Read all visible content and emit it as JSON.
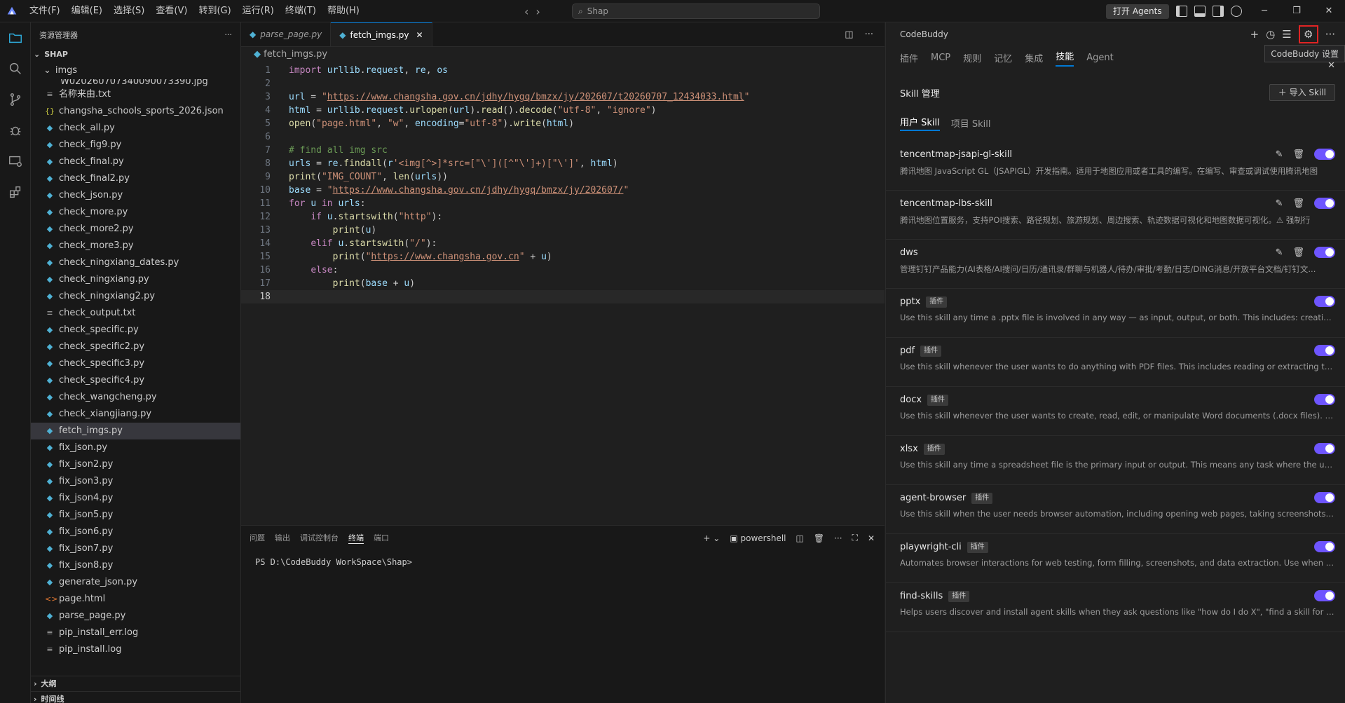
{
  "menu": [
    "文件(F)",
    "编辑(E)",
    "选择(S)",
    "查看(V)",
    "转到(G)",
    "运行(R)",
    "终端(T)",
    "帮助(H)"
  ],
  "search": {
    "text": "Shap"
  },
  "open_agents_label": "打开 Agents",
  "explorer": {
    "title": "资源管理器",
    "root": "SHAP",
    "folder": "imgs",
    "partial_file": "W020260707340090073390.jpg",
    "files": [
      {
        "name": "名称来由.txt",
        "type": "txt"
      },
      {
        "name": "changsha_schools_sports_2026.json",
        "type": "json"
      },
      {
        "name": "check_all.py",
        "type": "py"
      },
      {
        "name": "check_fig9.py",
        "type": "py"
      },
      {
        "name": "check_final.py",
        "type": "py"
      },
      {
        "name": "check_final2.py",
        "type": "py"
      },
      {
        "name": "check_json.py",
        "type": "py"
      },
      {
        "name": "check_more.py",
        "type": "py"
      },
      {
        "name": "check_more2.py",
        "type": "py"
      },
      {
        "name": "check_more3.py",
        "type": "py"
      },
      {
        "name": "check_ningxiang_dates.py",
        "type": "py"
      },
      {
        "name": "check_ningxiang.py",
        "type": "py"
      },
      {
        "name": "check_ningxiang2.py",
        "type": "py"
      },
      {
        "name": "check_output.txt",
        "type": "txt"
      },
      {
        "name": "check_specific.py",
        "type": "py"
      },
      {
        "name": "check_specific2.py",
        "type": "py"
      },
      {
        "name": "check_specific3.py",
        "type": "py"
      },
      {
        "name": "check_specific4.py",
        "type": "py"
      },
      {
        "name": "check_wangcheng.py",
        "type": "py"
      },
      {
        "name": "check_xiangjiang.py",
        "type": "py"
      },
      {
        "name": "fetch_imgs.py",
        "type": "py",
        "active": true
      },
      {
        "name": "fix_json.py",
        "type": "py"
      },
      {
        "name": "fix_json2.py",
        "type": "py"
      },
      {
        "name": "fix_json3.py",
        "type": "py"
      },
      {
        "name": "fix_json4.py",
        "type": "py"
      },
      {
        "name": "fix_json5.py",
        "type": "py"
      },
      {
        "name": "fix_json6.py",
        "type": "py"
      },
      {
        "name": "fix_json7.py",
        "type": "py"
      },
      {
        "name": "fix_json8.py",
        "type": "py"
      },
      {
        "name": "generate_json.py",
        "type": "py"
      },
      {
        "name": "page.html",
        "type": "html"
      },
      {
        "name": "parse_page.py",
        "type": "py"
      },
      {
        "name": "pip_install_err.log",
        "type": "txt"
      },
      {
        "name": "pip_install.log",
        "type": "txt"
      }
    ],
    "outline": "大纲",
    "timeline": "时间线"
  },
  "tabs": [
    {
      "label": "parse_page.py",
      "active": false
    },
    {
      "label": "fetch_imgs.py",
      "active": true
    }
  ],
  "breadcrumb": "fetch_imgs.py",
  "code_lines": [
    "import urllib.request, re, os",
    "",
    "url = \"https://www.changsha.gov.cn/jdhy/hygq/bmzx/jy/202607/t20260707_12434033.html\"",
    "html = urllib.request.urlopen(url).read().decode(\"utf-8\", \"ignore\")",
    "open(\"page.html\", \"w\", encoding=\"utf-8\").write(html)",
    "",
    "# find all img src",
    "urls = re.findall(r'<img[^>]*src=[\"\\']([^\"\\']+)[\"\\']', html)",
    "print(\"IMG_COUNT\", len(urls))",
    "base = \"https://www.changsha.gov.cn/jdhy/hygq/bmzx/jy/202607/\"",
    "for u in urls:",
    "    if u.startswith(\"http\"):",
    "        print(u)",
    "    elif u.startswith(\"/\"):",
    "        print(\"https://www.changsha.gov.cn\" + u)",
    "    else:",
    "        print(base + u)",
    ""
  ],
  "panel": {
    "tabs": [
      "问题",
      "输出",
      "调试控制台",
      "终端",
      "端口"
    ],
    "active_tab": "终端",
    "shell": "powershell",
    "prompt": "PS D:\\CodeBuddy WorkSpace\\Shap>"
  },
  "codebuddy": {
    "title": "CodeBuddy",
    "tooltip": "CodeBuddy 设置",
    "tabs": [
      "插件",
      "MCP",
      "规则",
      "记忆",
      "集成",
      "技能",
      "Agent"
    ],
    "active_tab": "技能",
    "section_title": "Skill 管理",
    "import_label": "导入 Skill",
    "subtabs": [
      "用户 Skill",
      "项目 Skill"
    ],
    "active_subtab": "用户 Skill",
    "plugin_badge": "插件",
    "skills": [
      {
        "name": "tencentmap-jsapi-gl-skill",
        "desc": "腾讯地图 JavaScript GL（JSAPIGL）开发指南。适用于地图应用或者工具的编写。在编写、审查或调试使用腾讯地图",
        "plugin": false,
        "editable": true
      },
      {
        "name": "tencentmap-lbs-skill",
        "desc": "腾讯地图位置服务，支持POI搜索、路径规划、旅游规划、周边搜索、轨迹数据可视化和地图数据可视化。⚠ 强制行",
        "plugin": false,
        "editable": true
      },
      {
        "name": "dws",
        "desc": "管理钉钉产品能力(AI表格/AI搜问/日历/通讯录/群聊与机器人/待办/审批/考勤/日志/DING消息/开放平台文档/钉钉文...",
        "plugin": false,
        "editable": true
      },
      {
        "name": "pptx",
        "desc": "Use this skill any time a .pptx file is involved in any way — as input, output, or both. This includes: creating slide d...",
        "plugin": true,
        "editable": false
      },
      {
        "name": "pdf",
        "desc": "Use this skill whenever the user wants to do anything with PDF files. This includes reading or extracting text/table...",
        "plugin": true,
        "editable": false
      },
      {
        "name": "docx",
        "desc": "Use this skill whenever the user wants to create, read, edit, or manipulate Word documents (.docx files). Triggers i...",
        "plugin": true,
        "editable": false
      },
      {
        "name": "xlsx",
        "desc": "Use this skill any time a spreadsheet file is the primary input or output. This means any task where the user wants...",
        "plugin": true,
        "editable": false
      },
      {
        "name": "agent-browser",
        "desc": "Use this skill when the user needs browser automation, including opening web pages, taking screenshots, extracti...",
        "plugin": true,
        "editable": false
      },
      {
        "name": "playwright-cli",
        "desc": "Automates browser interactions for web testing, form filling, screenshots, and data extraction. Use when the user ...",
        "plugin": true,
        "editable": false
      },
      {
        "name": "find-skills",
        "desc": "Helps users discover and install agent skills when they ask questions like \"how do I do X\", \"find a skill for X\", \"is th...",
        "plugin": true,
        "editable": false
      }
    ]
  }
}
